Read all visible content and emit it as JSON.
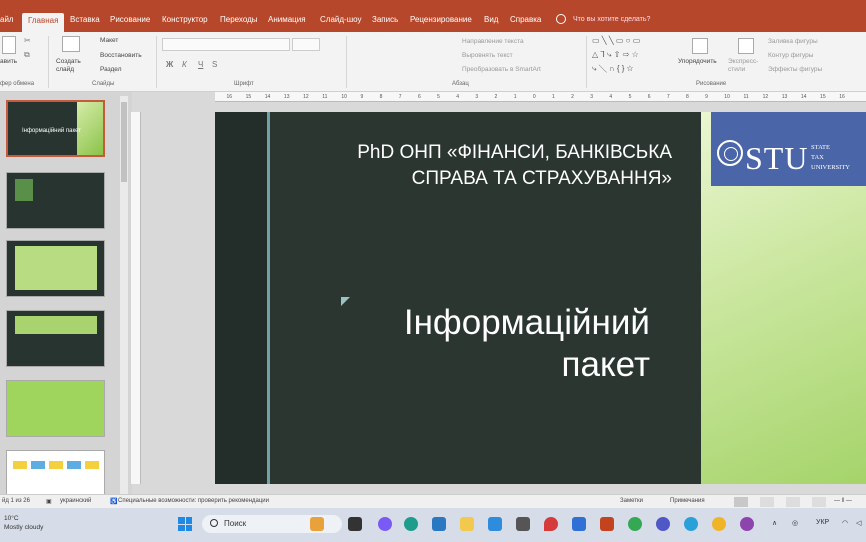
{
  "ribbon_tabs": [
    "айл",
    "Главная",
    "Вставка",
    "Рисование",
    "Конструктор",
    "Переходы",
    "Анимация",
    "Слайд-шоу",
    "Запись",
    "Рецензирование",
    "Вид",
    "Справка"
  ],
  "active_tab": "Главная",
  "tell_me": "Что вы хотите сделать?",
  "ribbon": {
    "paste_label": "авить",
    "clipboard_group": "фер обмена",
    "new_slide_label": "Создать слайд",
    "layout_label": "Макет",
    "reset_label": "Восстановить",
    "section_label": "Раздел",
    "slides_group": "Слайды",
    "font_group": "Шрифт",
    "font_buttons": [
      "Ж",
      "К",
      "Ч",
      "S"
    ],
    "paragraph_group": "Абзац",
    "text_direction": "Направление текста",
    "align_text": "Выровнять текст",
    "smartart": "Преобразовать в SmartArt",
    "arrange_label": "Упорядочить",
    "quick_styles_label": "Экспресс-стили",
    "shape_fill": "Заливка фигуры",
    "shape_outline": "Контур фигуры",
    "shape_effects": "Эффекты фигуры",
    "drawing_group": "Рисование"
  },
  "thumbnails": [
    {
      "text": "Інформаційний пакет"
    },
    {
      "text": ""
    },
    {
      "text": ""
    },
    {
      "text": ""
    },
    {
      "text": ""
    },
    {
      "text": ""
    }
  ],
  "ruler_ticks": [
    "16",
    "15",
    "14",
    "13",
    "12",
    "11",
    "10",
    "9",
    "8",
    "7",
    "6",
    "5",
    "4",
    "3",
    "2",
    "1",
    "0",
    "1",
    "2",
    "3",
    "4",
    "5",
    "6",
    "7",
    "8",
    "9",
    "10",
    "11",
    "12",
    "13",
    "14",
    "15",
    "16"
  ],
  "slide": {
    "title_line1": "PhD ОНП «ФІНАНСИ, БАНКІВСЬКА",
    "title_line2": "СПРАВА ТА СТРАХУВАННЯ»",
    "subtitle_line1": "Інформаційний",
    "subtitle_line2": "пакет",
    "logo_text": "STU",
    "logo_small": [
      "STATE",
      "TAX",
      "UNIVERSITY"
    ]
  },
  "statusbar": {
    "slide_counter": "йд 1 из 26",
    "language": "украинский",
    "accessibility": "Специальные возможности: проверить рекомендации",
    "notes": "Заметки",
    "comments": "Примечания"
  },
  "taskbar": {
    "temperature": "10°C",
    "weather": "Mostly cloudy",
    "search_placeholder": "Поиск",
    "language": "УКР"
  },
  "colors": {
    "accent": "#b7472a",
    "slide_dark": "#2b3630",
    "logo_blue": "#4a66a8"
  }
}
